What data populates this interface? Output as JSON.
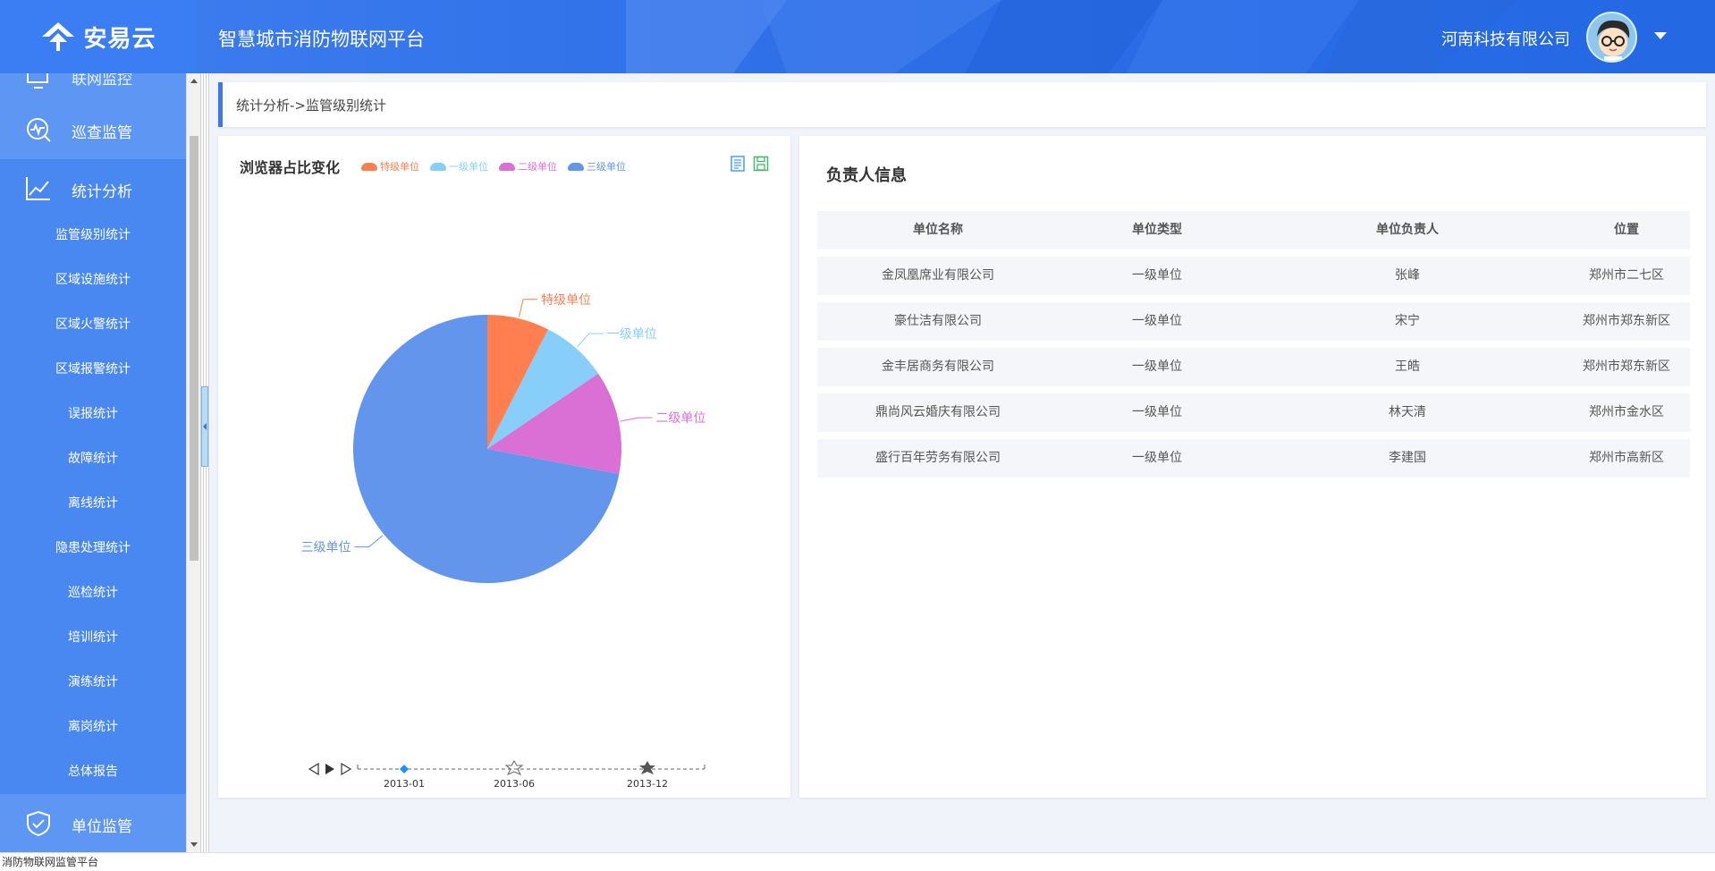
{
  "header": {
    "logo_text": "安易云",
    "platform_title": "智慧城市消防物联网平台",
    "company": "河南科技有限公司"
  },
  "sidebar": {
    "partial_item": "联网监控",
    "sections": [
      {
        "label": "巡查监管",
        "icon": "patrol-icon"
      },
      {
        "label": "统计分析",
        "icon": "chart-line-icon"
      },
      {
        "label": "单位监管",
        "icon": "shield-check-icon"
      }
    ],
    "sub_items": [
      "监管级别统计",
      "区域设施统计",
      "区域火警统计",
      "区域报警统计",
      "误报统计",
      "故障统计",
      "离线统计",
      "隐患处理统计",
      "巡检统计",
      "培训统计",
      "演练统计",
      "离岗统计",
      "总体报告"
    ]
  },
  "breadcrumb": "统计分析->监管级别统计",
  "chart_panel": {
    "title": "浏览器占比变化"
  },
  "chart_data": {
    "type": "pie",
    "title": "浏览器占比变化",
    "slices": [
      {
        "name": "特级单位",
        "value": 7.5,
        "color": "#ff7f50"
      },
      {
        "name": "一级单位",
        "value": 8,
        "color": "#87cefa"
      },
      {
        "name": "二级单位",
        "value": 12.5,
        "color": "#da70d6"
      },
      {
        "name": "三级单位",
        "value": 72,
        "color": "#6495ed"
      }
    ],
    "legend": [
      "特级单位",
      "一级单位",
      "二级单位",
      "三级单位"
    ],
    "legend_position": "top",
    "timeline": [
      "2013-01",
      "2013-06",
      "2013-12"
    ]
  },
  "table_panel": {
    "title": "负责人信息",
    "columns": [
      "单位名称",
      "单位类型",
      "单位负责人",
      "位置"
    ],
    "rows": [
      [
        "金凤凰席业有限公司",
        "一级单位",
        "张峰",
        "郑州市二七区"
      ],
      [
        "豪仕洁有限公司",
        "一级单位",
        "宋宁",
        "郑州市郑东新区"
      ],
      [
        "金丰居商务有限公司",
        "一级单位",
        "王皓",
        "郑州市郑东新区"
      ],
      [
        "鼎尚风云婚庆有限公司",
        "一级单位",
        "林天清",
        "郑州市金水区"
      ],
      [
        "盛行百年劳务有限公司",
        "一级单位",
        "李建国",
        "郑州市高新区"
      ]
    ]
  },
  "status_bar": "消防物联网监管平台",
  "colors": {
    "header_blue": "#2f6fe8",
    "sidebar_blue": "#4a88f1",
    "accent": "#3d78e6"
  }
}
